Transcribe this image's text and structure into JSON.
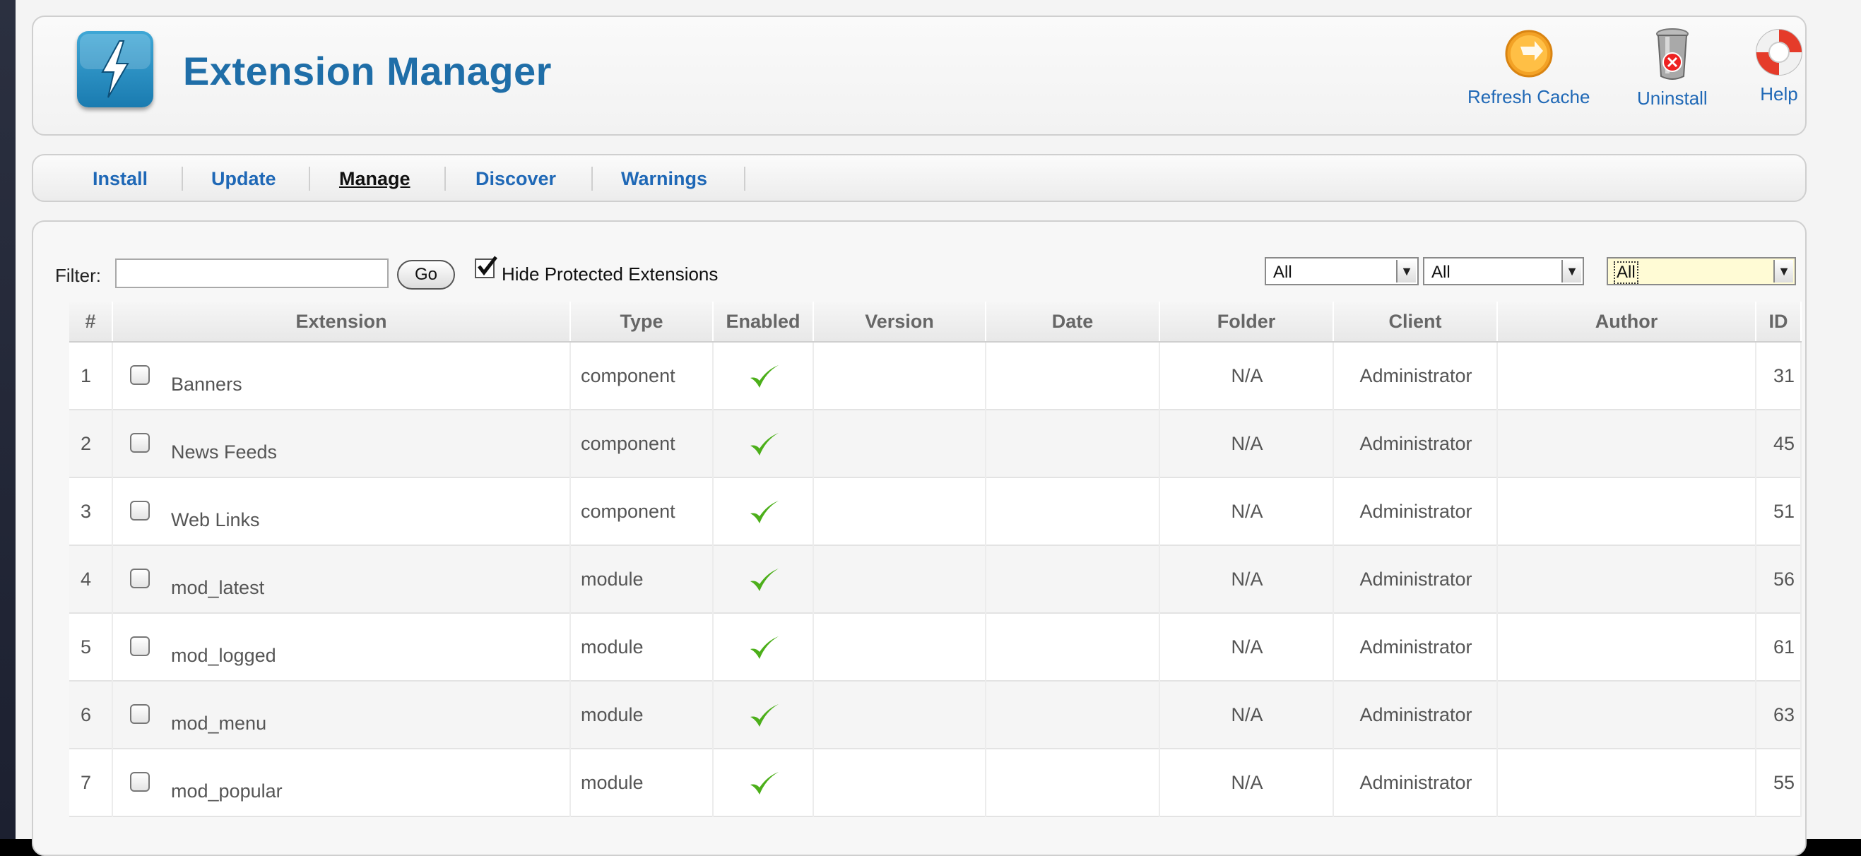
{
  "header": {
    "title": "Extension Manager",
    "toolbar": {
      "refresh_label": "Refresh Cache",
      "uninstall_label": "Uninstall",
      "help_label": "Help"
    }
  },
  "tabs": [
    {
      "label": "Install",
      "active": false
    },
    {
      "label": "Update",
      "active": false
    },
    {
      "label": "Manage",
      "active": true
    },
    {
      "label": "Discover",
      "active": false
    },
    {
      "label": "Warnings",
      "active": false
    }
  ],
  "filter": {
    "label": "Filter:",
    "value": "",
    "go_label": "Go",
    "hide_protected_label": "Hide Protected Extensions",
    "hide_protected_checked": true
  },
  "selects": [
    {
      "value": "All"
    },
    {
      "value": "All"
    },
    {
      "value": "All"
    }
  ],
  "table": {
    "columns": [
      "#",
      "Extension",
      "Type",
      "Enabled",
      "Version",
      "Date",
      "Folder",
      "Client",
      "Author",
      "ID"
    ],
    "rows": [
      {
        "num": "1",
        "name": "Banners",
        "type": "component",
        "enabled": true,
        "version": "",
        "date": "",
        "folder": "N/A",
        "client": "Administrator",
        "author": "",
        "id": "31"
      },
      {
        "num": "2",
        "name": "News Feeds",
        "type": "component",
        "enabled": true,
        "version": "",
        "date": "",
        "folder": "N/A",
        "client": "Administrator",
        "author": "",
        "id": "45"
      },
      {
        "num": "3",
        "name": "Web Links",
        "type": "component",
        "enabled": true,
        "version": "",
        "date": "",
        "folder": "N/A",
        "client": "Administrator",
        "author": "",
        "id": "51"
      },
      {
        "num": "4",
        "name": "mod_latest",
        "type": "module",
        "enabled": true,
        "version": "",
        "date": "",
        "folder": "N/A",
        "client": "Administrator",
        "author": "",
        "id": "56"
      },
      {
        "num": "5",
        "name": "mod_logged",
        "type": "module",
        "enabled": true,
        "version": "",
        "date": "",
        "folder": "N/A",
        "client": "Administrator",
        "author": "",
        "id": "61"
      },
      {
        "num": "6",
        "name": "mod_menu",
        "type": "module",
        "enabled": true,
        "version": "",
        "date": "",
        "folder": "N/A",
        "client": "Administrator",
        "author": "",
        "id": "63"
      },
      {
        "num": "7",
        "name": "mod_popular",
        "type": "module",
        "enabled": true,
        "version": "",
        "date": "",
        "folder": "N/A",
        "client": "Administrator",
        "author": "",
        "id": "55"
      }
    ]
  },
  "colors": {
    "title": "#1f6ea8",
    "link": "#1f68b6",
    "check": "#4caf1a"
  }
}
